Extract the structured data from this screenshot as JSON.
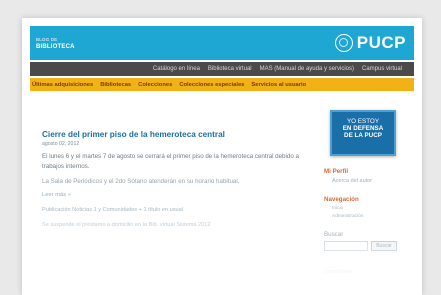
{
  "header": {
    "blog_small": "BLOG DE",
    "blog_name": "BIBLIOTECA",
    "logo_text": "PUCP",
    "color": "#1fa7d3"
  },
  "nav_primary": [
    "Catálogo en línea",
    "Biblioteca virtual",
    "MAS (Manual de ayuda y servicios)",
    "Campus virtual"
  ],
  "nav_secondary": [
    "Últimas adquisiciones",
    "Bibliotecas",
    "Colecciones",
    "Colecciones especiales",
    "Servicios al usuario"
  ],
  "post": {
    "title": "Cierre del primer piso de la hemeroteca central",
    "date": "agosto 02, 2012",
    "para1": "El lunes 6 y el martes 7 de agosto se cerrará el primer piso de la hemeroteca central debido a trabajos internos.",
    "para2": "La Sala de Periódicos y el 2do Sótano atenderán en su horario habitual.",
    "leer_mas": "Leer más »",
    "next1": "Publicación Noticias 1 y Comunidades + 1 título en usual",
    "next2": "Se suspende el préstamo a domicilio en la Bib. virtual Sistema 2012"
  },
  "sidebar": {
    "banner_line1": "YO ESTOY",
    "banner_line2": "EN DEFENSA",
    "banner_line3": "DE LA PUCP",
    "perfil_heading": "Mi Perfil",
    "perfil_link": "Acerca del autor",
    "nav_heading": "Navegación",
    "nav_sub1": "Inicio",
    "nav_sub2": "Administración",
    "search_label": "Buscar",
    "search_button": "Buscar",
    "faded_label": "Suscribirse"
  }
}
